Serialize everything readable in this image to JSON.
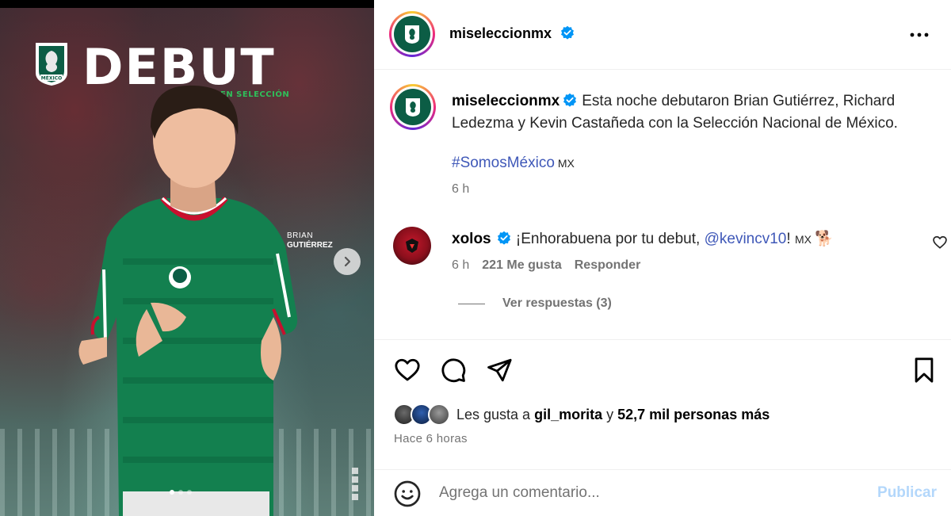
{
  "media": {
    "title": "DEBUT",
    "subtitle": "EN SELECCIÓN",
    "badge_text": "MÉXICO",
    "player_first": "BRIAN",
    "player_last": "GUTIÉRREZ",
    "carousel": {
      "count": 3,
      "active_index": 0
    },
    "next_icon": "chevron-right-icon"
  },
  "header": {
    "username": "miseleccionmx",
    "verified": true,
    "more_icon": "more-horizontal-icon"
  },
  "caption": {
    "username": "miseleccionmx",
    "text": "Esta noche debutaron Brian Gutiérrez, Richard Ledezma y Kevin Castañeda con la Selección Nacional de México.",
    "hashtag": "#SomosMéxico",
    "flag": "MX",
    "time": "6 h"
  },
  "comment": {
    "username": "xolos",
    "text_before": "¡Enhorabuena por tu debut, ",
    "mention": "@kevincv10",
    "text_after": "! ",
    "flag": "MX",
    "emoji": "🐕",
    "time": "6 h",
    "likes": "221 Me gusta",
    "reply_label": "Responder",
    "view_replies": "Ver respuestas (3)"
  },
  "actions": {
    "like_icon": "heart-icon",
    "comment_icon": "comment-icon",
    "share_icon": "send-icon",
    "save_icon": "bookmark-icon"
  },
  "likes": {
    "prefix": "Les gusta a ",
    "user": "gil_morita",
    "middle": " y ",
    "count": "52,7 mil personas más",
    "time_ago": "Hace 6 horas"
  },
  "composer": {
    "placeholder": "Agrega un comentario...",
    "publish_label": "Publicar",
    "emoji_icon": "smiley-icon"
  },
  "colors": {
    "link": "#3f58b8",
    "verified": "#0095f6",
    "publish_disabled": "#b3d7fb",
    "crest_green": "#0c5d45",
    "jersey_green": "#13804f",
    "jersey_trim": "#c8102e"
  }
}
